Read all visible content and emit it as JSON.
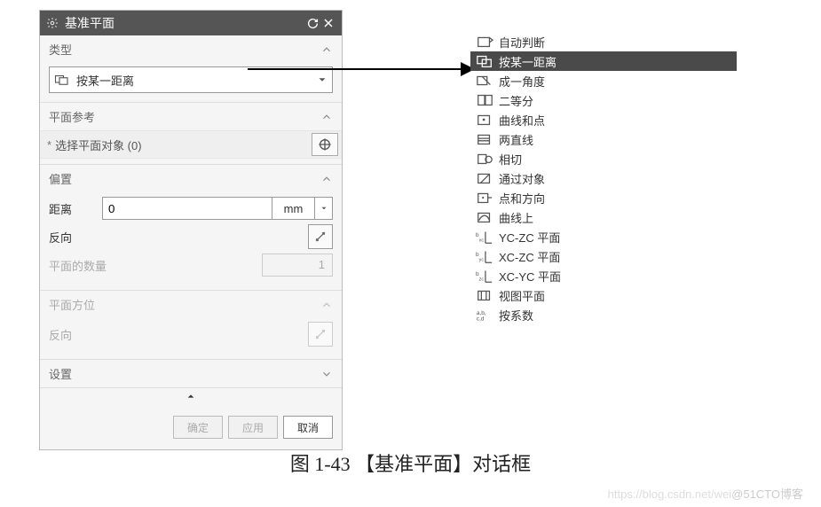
{
  "dialog": {
    "title": "基准平面",
    "sections": {
      "type": {
        "label": "类型",
        "dropdown_value": "按某一距离"
      },
      "plane_ref": {
        "label": "平面参考",
        "select_text": "选择平面对象 (0)"
      },
      "offset": {
        "label": "偏置",
        "distance_label": "距离",
        "distance_value": "0",
        "distance_unit": "mm",
        "reverse_label": "反向",
        "count_label": "平面的数量",
        "count_value": "1"
      },
      "orientation": {
        "label": "平面方位",
        "reverse_label": "反向"
      },
      "settings": {
        "label": "设置"
      }
    },
    "buttons": {
      "ok": "确定",
      "apply": "应用",
      "cancel": "取消"
    }
  },
  "menu_items": [
    {
      "icon": "auto-detect-icon",
      "label": "自动判断",
      "selected": false
    },
    {
      "icon": "distance-icon",
      "label": "按某一距离",
      "selected": true
    },
    {
      "icon": "angle-icon",
      "label": "成一角度",
      "selected": false
    },
    {
      "icon": "bisect-icon",
      "label": "二等分",
      "selected": false
    },
    {
      "icon": "curve-point-icon",
      "label": "曲线和点",
      "selected": false
    },
    {
      "icon": "two-lines-icon",
      "label": "两直线",
      "selected": false
    },
    {
      "icon": "tangent-icon",
      "label": "相切",
      "selected": false
    },
    {
      "icon": "through-object-icon",
      "label": "通过对象",
      "selected": false
    },
    {
      "icon": "point-direction-icon",
      "label": "点和方向",
      "selected": false
    },
    {
      "icon": "on-curve-icon",
      "label": "曲线上",
      "selected": false
    },
    {
      "icon": "yczc-plane-icon",
      "label": "YC-ZC 平面",
      "selected": false
    },
    {
      "icon": "xczc-plane-icon",
      "label": "XC-ZC 平面",
      "selected": false
    },
    {
      "icon": "xcyc-plane-icon",
      "label": "XC-YC 平面",
      "selected": false
    },
    {
      "icon": "view-plane-icon",
      "label": "视图平面",
      "selected": false
    },
    {
      "icon": "coefficient-icon",
      "label": "按系数",
      "selected": false
    }
  ],
  "caption": "图 1-43    【基准平面】对话框",
  "watermark": {
    "prefix": "https://blog.csdn.net/wei",
    "suffix": "@51CTO博客"
  }
}
